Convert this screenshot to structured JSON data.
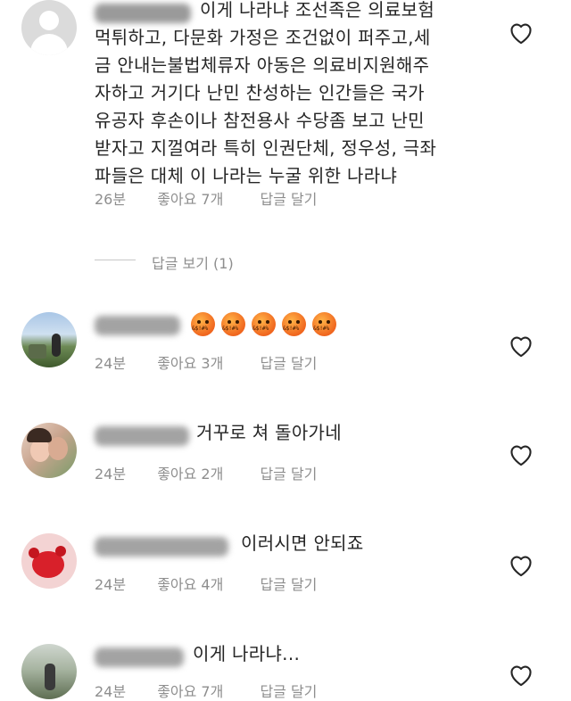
{
  "comments": [
    {
      "username": "seeqt0000",
      "text_lines": [
        "이게 나라냐 조선족은 의료보험",
        "먹튀하고, 다문화 가정은 조건없이 퍼주고,세",
        "금 안내는불법체류자 아동은 의료비지원해주",
        "자하고 거기다 난민 찬성하는 인간들은 국가",
        "유공자 후손이나 참전용사 수당좀 보고 난민",
        "받자고 지껄여라 특히 인권단체, 정우성, 극좌",
        "파들은 대체 이 나라는 누굴 위한 나라냐"
      ],
      "time": "26분",
      "likes": "좋아요 7개",
      "reply": "답글 달기"
    },
    {
      "username": "hyeji_day",
      "emoji_label": "&$!#%",
      "emoji_count": 5,
      "time": "24분",
      "likes": "좋아요 3개",
      "reply": "답글 달기"
    },
    {
      "username": "wxymaxx",
      "text": "거꾸로 쳐 돌아가네",
      "time": "24분",
      "likes": "좋아요 2개",
      "reply": "답글 달기"
    },
    {
      "username": "hailey.chul05",
      "text": "이러시면 안되죠",
      "time": "24분",
      "likes": "좋아요 4개",
      "reply": "답글 달기"
    },
    {
      "username": "j.h_ia_vip",
      "text": "이게 나라냐...",
      "time": "24분",
      "likes": "좋아요 7개",
      "reply": "답글 달기"
    }
  ],
  "view_replies": "답글 보기 (1)",
  "icons": {
    "heart": "heart-outline-icon"
  },
  "colors": {
    "text": "#262626",
    "meta": "#8e8e8e"
  }
}
